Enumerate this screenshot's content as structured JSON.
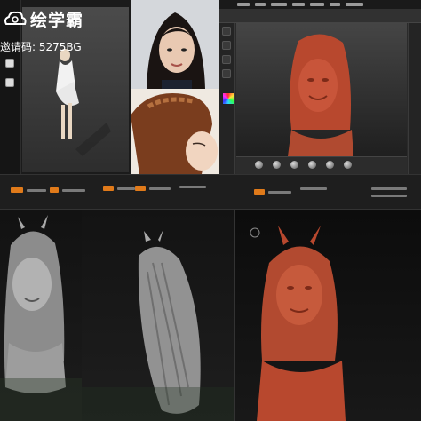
{
  "brand": {
    "title": "绘学霸",
    "invite": "邀请码: 5275BG"
  },
  "colors": {
    "accent": "#e07a1a",
    "clay_red": "#c8553a",
    "clay_grey": "#9a9a9a",
    "viewport_bg": "#3d3d3d"
  },
  "icons": [
    "logo-cloud-icon",
    "document-icon",
    "color-picker-icon",
    "material-ball-icon"
  ]
}
